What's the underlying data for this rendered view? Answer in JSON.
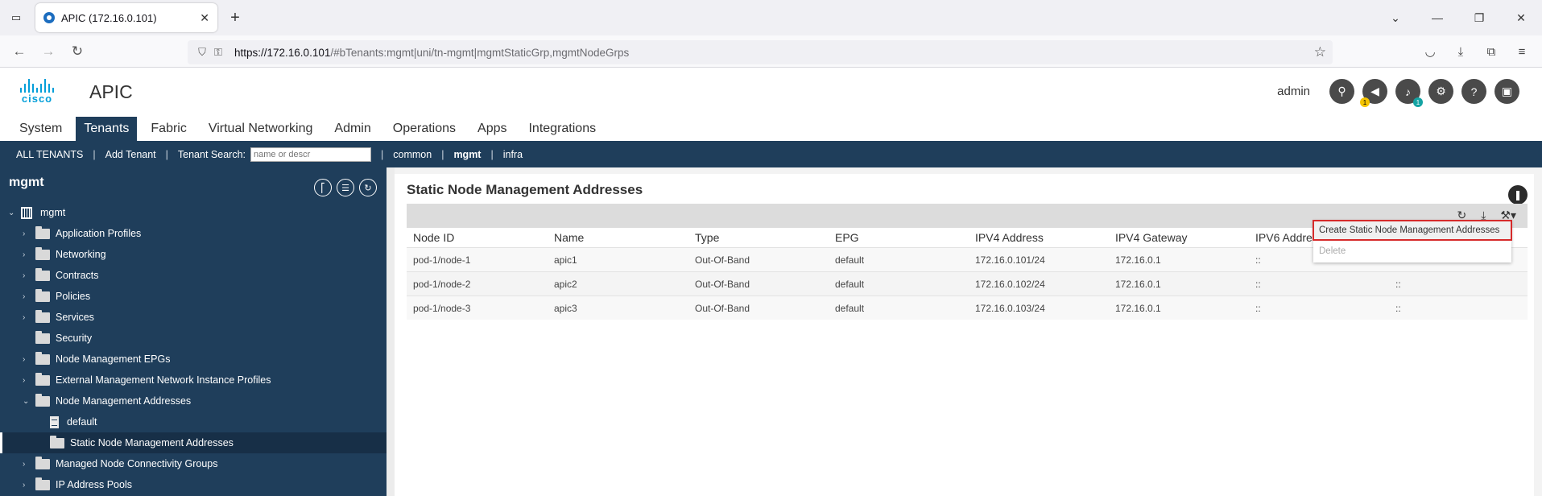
{
  "browser": {
    "tab_title": "APIC (172.16.0.101)",
    "url_host": "https://172.16.0.101",
    "url_path": "/#bTenants:mgmt|uni/tn-mgmt|mgmtStaticGrp,mgmtNodeGrps"
  },
  "app": {
    "logo_text": "cisco",
    "name": "APIC",
    "user": "admin",
    "badges": {
      "alerts": "1",
      "notifications": "1"
    }
  },
  "main_menu": [
    "System",
    "Tenants",
    "Fabric",
    "Virtual Networking",
    "Admin",
    "Operations",
    "Apps",
    "Integrations"
  ],
  "sub_menu": {
    "all_tenants": "ALL TENANTS",
    "add_tenant": "Add Tenant",
    "search_label": "Tenant Search:",
    "search_placeholder": "name or descr",
    "common": "common",
    "mgmt": "mgmt",
    "infra": "infra"
  },
  "sidebar": {
    "title": "mgmt",
    "root": "mgmt",
    "items": [
      "Application Profiles",
      "Networking",
      "Contracts",
      "Policies",
      "Services",
      "Security",
      "Node Management EPGs",
      "External Management Network Instance Profiles",
      "Node Management Addresses",
      "default",
      "Static Node Management Addresses",
      "Managed Node Connectivity Groups",
      "IP Address Pools"
    ]
  },
  "main": {
    "title": "Static Node Management Addresses",
    "columns": [
      "Node ID",
      "Name",
      "Type",
      "EPG",
      "IPV4 Address",
      "IPV4 Gateway",
      "IPV6 Address",
      ""
    ],
    "rows": [
      [
        "pod-1/node-1",
        "apic1",
        "Out-Of-Band",
        "default",
        "172.16.0.101/24",
        "172.16.0.1",
        "::",
        ""
      ],
      [
        "pod-1/node-2",
        "apic2",
        "Out-Of-Band",
        "default",
        "172.16.0.102/24",
        "172.16.0.1",
        "::",
        "::"
      ],
      [
        "pod-1/node-3",
        "apic3",
        "Out-Of-Band",
        "default",
        "172.16.0.103/24",
        "172.16.0.1",
        "::",
        "::"
      ]
    ],
    "context_menu": {
      "create": "Create Static Node Management Addresses",
      "delete": "Delete"
    }
  }
}
